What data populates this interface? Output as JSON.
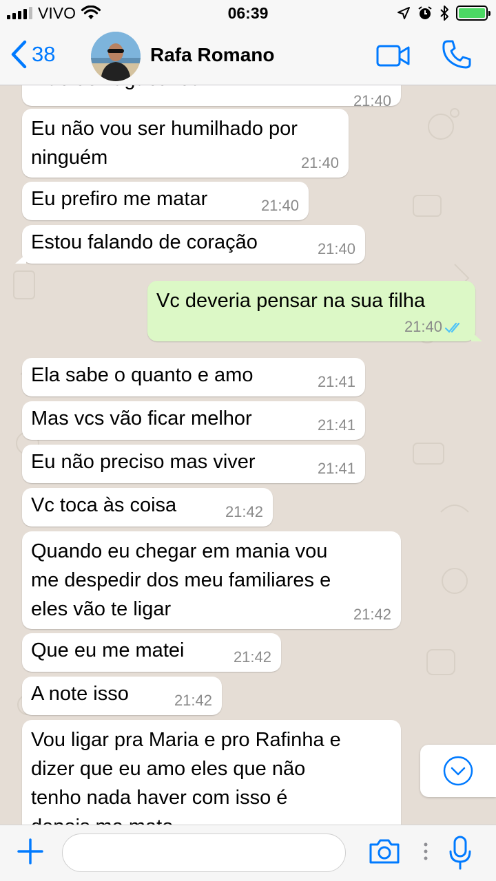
{
  "status_bar": {
    "carrier": "VIVO",
    "time": "06:39"
  },
  "header": {
    "back_count": "38",
    "contact_name": "Rafa Romano"
  },
  "messages": [
    {
      "direction": "in",
      "text": [
        "mãe de vagabunda"
      ],
      "time": "21:40"
    },
    {
      "direction": "in",
      "text": [
        "Eu não vou ser humilhado por",
        "ninguém"
      ],
      "time": "21:40"
    },
    {
      "direction": "in",
      "text": [
        "Eu prefiro me matar"
      ],
      "time": "21:40"
    },
    {
      "direction": "in",
      "text": [
        "Estou falando de coração"
      ],
      "time": "21:40"
    },
    {
      "direction": "out",
      "text": [
        "Vc deveria pensar na sua filha"
      ],
      "time": "21:40",
      "status": "read"
    },
    {
      "direction": "in",
      "text": [
        "Ela sabe o quanto e amo"
      ],
      "time": "21:41"
    },
    {
      "direction": "in",
      "text": [
        "Mas vcs vão ficar melhor"
      ],
      "time": "21:41"
    },
    {
      "direction": "in",
      "text": [
        "Eu não preciso mas viver"
      ],
      "time": "21:41"
    },
    {
      "direction": "in",
      "text": [
        "Vc toca às coisa"
      ],
      "time": "21:42"
    },
    {
      "direction": "in",
      "text": [
        "Quando eu chegar em mania vou",
        "me despedir dos meu familiares e",
        "eles vão te ligar"
      ],
      "time": "21:42"
    },
    {
      "direction": "in",
      "text": [
        "Que eu me matei"
      ],
      "time": "21:42"
    },
    {
      "direction": "in",
      "text": [
        "A note isso"
      ],
      "time": "21:42"
    },
    {
      "direction": "in",
      "text": [
        "Vou ligar pra Maria e pro Rafinha e",
        "dizer que eu amo eles que não",
        "tenho nada haver com isso é",
        "depois me mato"
      ],
      "time": ""
    }
  ],
  "composer": {
    "placeholder": ""
  },
  "colors": {
    "accent": "#007aff",
    "incoming_bubble": "#ffffff",
    "outgoing_bubble": "#dcf8c6",
    "chat_background": "#e5ddd5",
    "read_ticks": "#4fc3f7",
    "battery": "#4cd964"
  },
  "icons": [
    "signal-icon",
    "wifi-icon",
    "location-icon",
    "alarm-icon",
    "bluetooth-icon",
    "battery-icon",
    "back-chevron-icon",
    "video-call-icon",
    "phone-icon",
    "read-receipt-icon",
    "scroll-down-icon",
    "plus-icon",
    "camera-icon",
    "mic-icon"
  ]
}
